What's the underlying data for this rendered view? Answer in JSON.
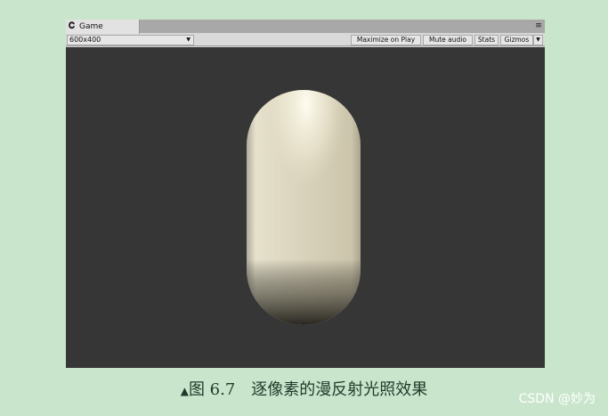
{
  "window": {
    "tab_title": "Game",
    "tab_icon": "unity-icon",
    "menu_icon": "menu-icon"
  },
  "toolbar": {
    "resolution": "600x400",
    "maximize_on_play": "Maximize on Play",
    "mute_audio": "Mute audio",
    "stats": "Stats",
    "gizmos": "Gizmos"
  },
  "colors": {
    "viewport_bg": "#363636",
    "capsule_light": "#fdf8e4",
    "capsule_mid": "#d6cfb8",
    "capsule_shadow": "#2e2b24",
    "page_bg": "#c9e6cc"
  },
  "caption": {
    "text": "图 6.7　逐像素的漫反射光照效果"
  },
  "watermark": "CSDN @妙为"
}
